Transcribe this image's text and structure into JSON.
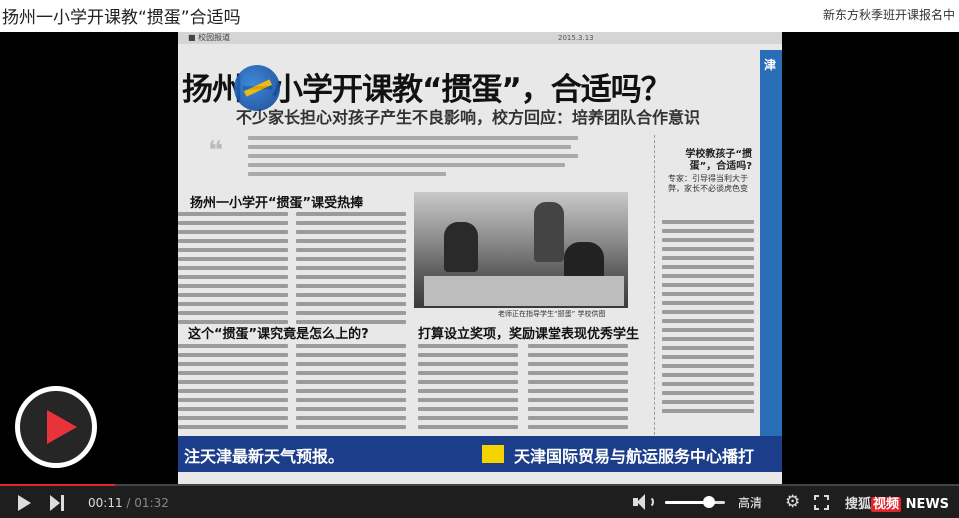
{
  "page": {
    "title": "扬州一小学开课教“掼蛋”合适吗",
    "promo_link": "新东方秋季班开课报名中"
  },
  "video_frame": {
    "paper_section": "■ 校园报道",
    "paper_date": "2015.3.13",
    "headline": "扬州一小学开课教“掼蛋”，合适吗？",
    "subhead": "不少家长担心对孩子产生不良影响，校方回应：培养团队合作意识",
    "section1": "扬州一小学开“掼蛋”课受热捧",
    "section2": "这个“掼蛋”课究竟是怎么上的?",
    "section3": "打算设立奖项，奖励课堂表现优秀学生",
    "photo_caption": "老师正在指导学生“掼蛋” 学校供图",
    "sidebar_title": "学校教孩子“掼蛋”，合适吗?",
    "sidebar_sub": "专家：引导得当利大于弊，家长不必谈虎色变",
    "right_strip": "津",
    "ticker_left": "注天津最新天气预报。",
    "ticker_right": "天津国际贸易与航运服务中心播打"
  },
  "player": {
    "current_time": "00:11",
    "separator": "/",
    "duration": "01:32",
    "progress_fraction": 0.12,
    "volume_fraction": 0.75,
    "quality_label": "高清",
    "brand_prefix": "搜狐",
    "brand_mid": "视频",
    "brand_suffix": "NEWS",
    "accent_color": "#e0242a"
  }
}
